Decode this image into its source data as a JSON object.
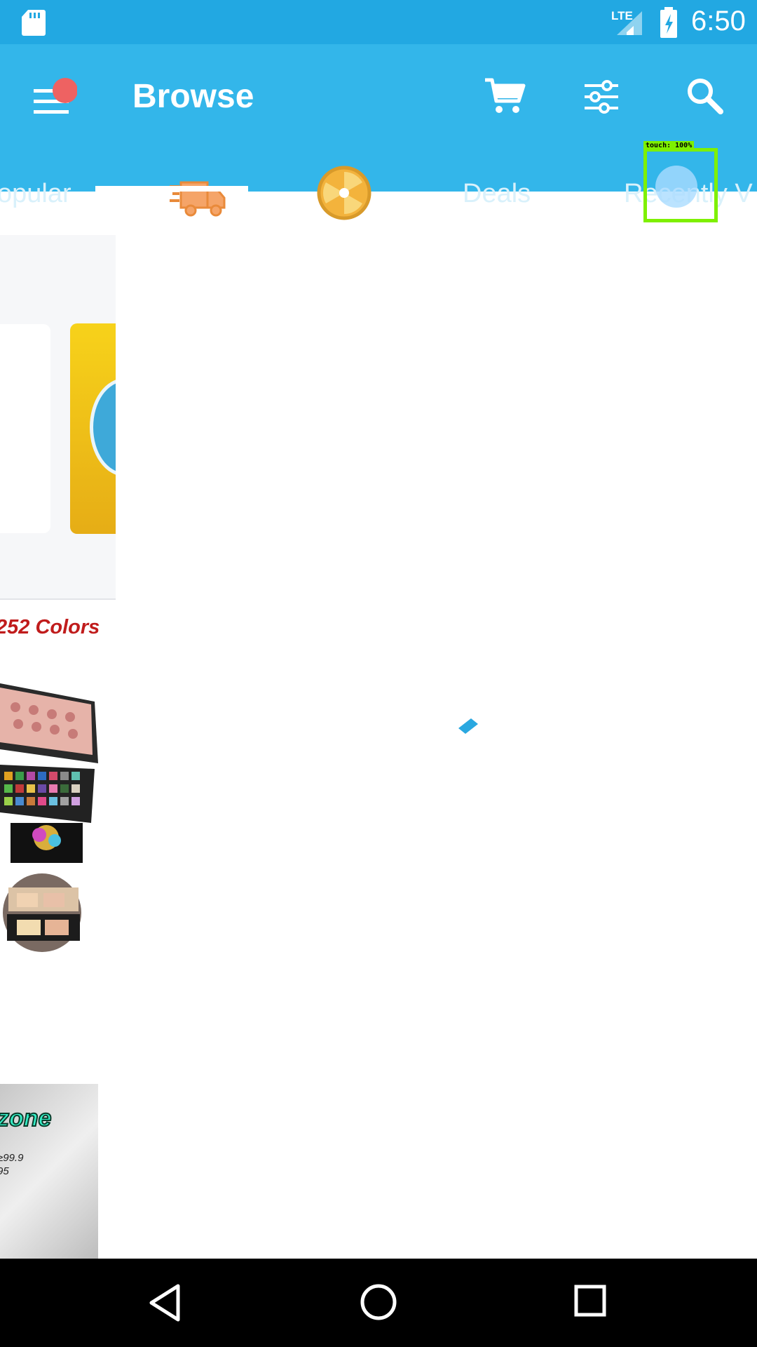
{
  "status_bar": {
    "time": "6:50",
    "network": "LTE"
  },
  "app_bar": {
    "title": "Browse"
  },
  "tabs": [
    {
      "label": "opular"
    },
    {
      "label": ""
    },
    {
      "label": ""
    },
    {
      "label": "Deals"
    },
    {
      "label": "Recently V"
    }
  ],
  "touch_overlay": {
    "label": "touch: 100%"
  },
  "side_content": {
    "banner_text": "252 Colors",
    "promo_title": "zone",
    "promo_line1": "≥99.9",
    "promo_line2": "95"
  },
  "colors": {
    "status_bar": "#22a8e2",
    "app_bar": "#33b6ea",
    "accent": "#2aa8e0"
  },
  "icons": [
    "sd-card-icon",
    "lte-signal-icon",
    "battery-charging-icon",
    "menu-icon",
    "cart-icon",
    "filter-icon",
    "search-icon",
    "delivery-truck-icon",
    "wheel-icon",
    "back-icon",
    "home-icon",
    "recents-icon"
  ]
}
